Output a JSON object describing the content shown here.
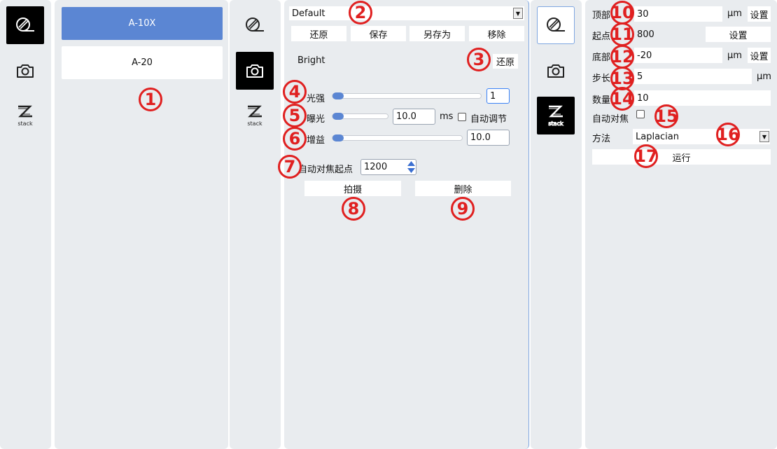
{
  "colors": {
    "accent": "#5b86d3",
    "badge": "#e02020",
    "panel": "#e9ecef"
  },
  "left_toolbar": {
    "icons": [
      "objective-icon",
      "camera-icon",
      "zstack-icon"
    ],
    "zstack_label": "stack"
  },
  "lens_list": {
    "items": [
      {
        "label": "A-10X",
        "selected": true
      },
      {
        "label": "A-20",
        "selected": false
      }
    ]
  },
  "mid_toolbar": {
    "zstack_label": "stack"
  },
  "camera": {
    "preset": "Default",
    "buttons": {
      "restore": "还原",
      "save": "保存",
      "save_as": "另存为",
      "remove": "移除"
    },
    "mode_label": "Bright",
    "mode_restore": "还原",
    "intensity": {
      "label": "光强",
      "value": "1",
      "level": 0.0
    },
    "exposure": {
      "label": "曝光",
      "value": "10.0",
      "unit": "ms",
      "auto_label": "自动调节",
      "level": 0.0
    },
    "gain": {
      "label": "增益",
      "value": "10.0",
      "level": 0.0
    },
    "af_start": {
      "label": "自动对焦起点",
      "value": "1200"
    },
    "capture": "拍摄",
    "delete": "删除"
  },
  "right_toolbar": {
    "zstack_label": "stack"
  },
  "zstack": {
    "top": {
      "label": "顶部",
      "value": "30",
      "unit": "μm",
      "set": "设置"
    },
    "start": {
      "label": "起点",
      "value": "800",
      "set": "设置"
    },
    "bottom": {
      "label": "底部",
      "value": "-20",
      "unit": "μm",
      "set": "设置"
    },
    "step": {
      "label": "步长",
      "value": "5",
      "unit": "μm"
    },
    "count": {
      "label": "数量",
      "value": "10"
    },
    "autofocus": {
      "label": "自动对焦"
    },
    "method": {
      "label": "方法",
      "value": "Laplacian"
    },
    "run": "运行"
  },
  "badges": [
    "1",
    "2",
    "3",
    "4",
    "5",
    "6",
    "7",
    "8",
    "9",
    "10",
    "11",
    "12",
    "13",
    "14",
    "15",
    "16",
    "17"
  ]
}
